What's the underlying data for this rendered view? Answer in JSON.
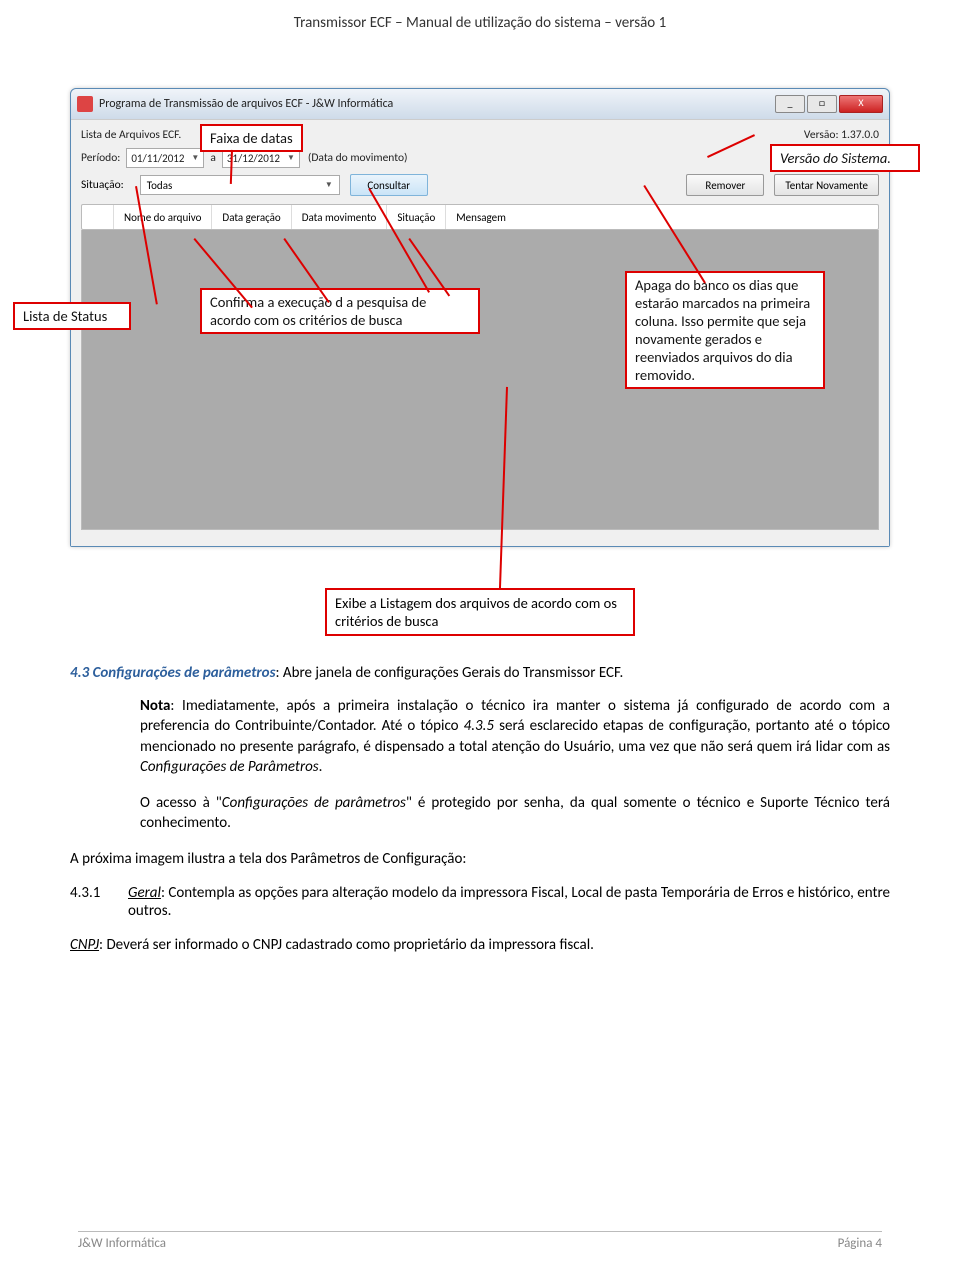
{
  "doc_header": "Transmissor ECF – Manual de utilização do sistema – versão 1",
  "window": {
    "title": "Programa de Transmissão de arquivos ECF - J&W Informática",
    "list_label": "Lista de Arquivos ECF.",
    "version_label": "Versão:",
    "version_value": "1.37.0.0",
    "periodo_label": "Período:",
    "date_from": "01/11/2012",
    "date_to": "31/12/2012",
    "date_sep": "a",
    "date_hint": "(Data do movimento)",
    "situacao_label": "Situação:",
    "situacao_value": "Todas",
    "btn_consultar": "Consultar",
    "btn_remover": "Remover",
    "btn_tentar": "Tentar Novamente",
    "cols": {
      "nome": "Nome do arquivo",
      "data_ger": "Data geração",
      "data_mov": "Data movimento",
      "sit": "Situação",
      "msg": "Mensagem"
    }
  },
  "callouts": {
    "faixa_datas": "Faixa de datas",
    "versao_sistema": "Versão do Sistema.",
    "lista_status": "Lista de Status",
    "confirma": "Confirma a execução d a pesquisa de acordo com os critérios de busca",
    "apaga": "Apaga do banco os dias que estarão marcados na primeira coluna. Isso permite que seja novamente gerados e reenviados arquivos do dia removido.",
    "exibe": "Exibe a Listagem dos arquivos de acordo com os critérios de busca"
  },
  "section": {
    "num": "4.3 ",
    "title": "Configurações de parâmetros",
    "rest": ": Abre janela de configurações Gerais do Transmissor ECF."
  },
  "note": {
    "label": "Nota",
    "text1": ": Imediatamente, após a primeira instalação o técnico ira manter o sistema já configurado de acordo com a preferencia do Contribuinte/Contador. Até o tópico ",
    "ref": "4.3.5",
    "text2": " será esclarecido etapas de configuração, portanto até o tópico mencionado no presente parágrafo, é dispensado a total atenção do Usuário, uma vez que não será quem irá lidar com as ",
    "conf": "Configurações de Parâmetros",
    "dot": "."
  },
  "access": {
    "p1": "O acesso à \"",
    "cf": "Configurações de parâmetros",
    "p2": "\" é protegido por senha, da qual somente o técnico e Suporte Técnico terá conhecimento."
  },
  "next_image": "A próxima imagem ilustra a tela dos Parâmetros de Configuração:",
  "sub431": {
    "num": "4.3.1",
    "title": "Geral",
    "rest": ": Contempla as opções para alteração modelo da impressora Fiscal, Local de pasta Temporária de Erros e histórico, entre outros."
  },
  "cnpj": {
    "label": "CNPJ",
    "rest": ": Deverá ser informado o CNPJ cadastrado como proprietário da impressora fiscal."
  },
  "footer": {
    "left": "J&W Informática",
    "right": "Página 4"
  }
}
